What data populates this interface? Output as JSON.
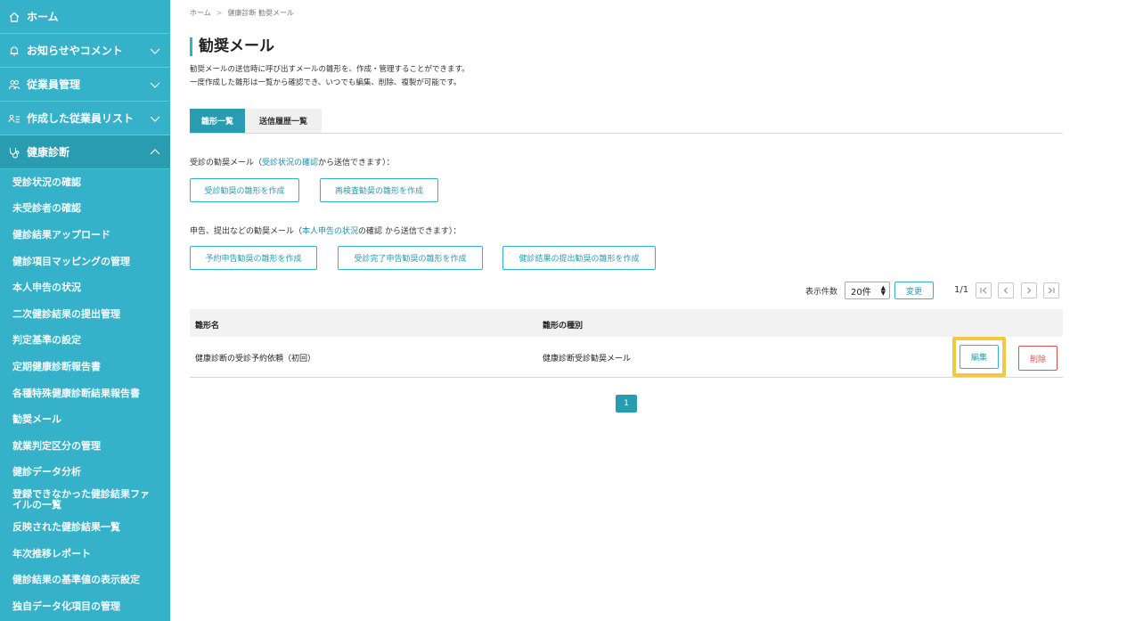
{
  "sidebar": {
    "home": "ホーム",
    "notices": "お知らせやコメント",
    "employees": "従業員管理",
    "lists": "作成した従業員リスト",
    "health": "健康診断",
    "sub_items": [
      "受診状況の確認",
      "未受診者の確認",
      "健診結果アップロード",
      "健診項目マッピングの管理",
      "本人申告の状況",
      "二次健診結果の提出管理",
      "判定基準の設定",
      "定期健康診断報告書",
      "各種特殊健康診断結果報告書",
      "勧奨メール",
      "就業判定区分の管理",
      "健診データ分析",
      "登録できなかった健診結果ファイルの一覧",
      "反映された健診結果一覧",
      "年次推移レポート",
      "健診結果の基準値の表示設定",
      "独自データ化項目の管理"
    ],
    "current_index": 9
  },
  "breadcrumb": {
    "home": "ホーム",
    "sep": ">",
    "current": "健康診断 勧奨メール"
  },
  "page": {
    "title": "勧奨メール",
    "desc_line1": "勧奨メールの送信時に呼び出すメールの雛形を、作成・管理することができます。",
    "desc_line2": "一度作成した雛形は一覧から確認でき、いつでも編集、削除、複製が可能です。"
  },
  "tabs": {
    "templates": "雛形一覧",
    "history": "送信履歴一覧"
  },
  "section1": {
    "prefix": "受診の勧奨メール（",
    "link": "受診状況の確認",
    "suffix": "から送信できます）：",
    "btn_exam": "受診勧奨の雛形を作成",
    "btn_reexam": "再検査勧奨の雛形を作成"
  },
  "section2": {
    "prefix": "申告、提出などの勧奨メール（",
    "link": "本人申告の状況",
    "suffix": "の確認 から送信できます）：",
    "btn_reserve": "予約申告勧奨の雛形を作成",
    "btn_done": "受診完了申告勧奨の雛形を作成",
    "btn_submit": "健診結果の提出勧奨の雛形を作成"
  },
  "pager": {
    "per_page_label": "表示件数",
    "per_page_value": "20件",
    "change": "変更",
    "count": "1/1",
    "current_page": "1"
  },
  "table": {
    "col_name": "雛形名",
    "col_type": "雛形の種別",
    "rows": [
      {
        "name": "健康診断の受診予約依頼（初回）",
        "type": "健康診断受診勧奨メール",
        "edit": "編集",
        "delete": "削除"
      }
    ]
  }
}
